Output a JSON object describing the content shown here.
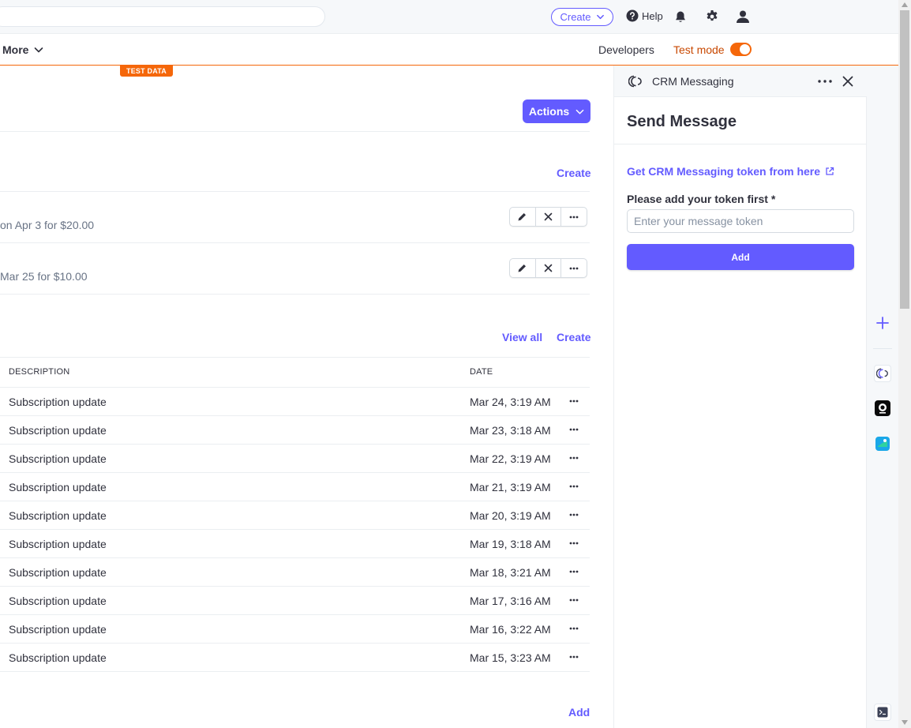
{
  "topbar": {
    "create_label": "Create",
    "help_label": "Help"
  },
  "nav": {
    "more_label": "More",
    "developers_label": "Developers",
    "test_mode_label": "Test mode",
    "test_mode_on": true,
    "test_data_badge": "TEST DATA"
  },
  "main": {
    "actions_label": "Actions",
    "section1": {
      "create_label": "Create",
      "items": [
        {
          "text": "on Apr 3 for $20.00"
        },
        {
          "text": "Mar 25 for $10.00"
        }
      ]
    },
    "section2": {
      "view_all_label": "View all",
      "create_label": "Create",
      "columns": {
        "description": "DESCRIPTION",
        "date": "DATE"
      },
      "rows": [
        {
          "description": "Subscription update",
          "date": "Mar 24, 3:19 AM"
        },
        {
          "description": "Subscription update",
          "date": "Mar 23, 3:18 AM"
        },
        {
          "description": "Subscription update",
          "date": "Mar 22, 3:19 AM"
        },
        {
          "description": "Subscription update",
          "date": "Mar 21, 3:19 AM"
        },
        {
          "description": "Subscription update",
          "date": "Mar 20, 3:19 AM"
        },
        {
          "description": "Subscription update",
          "date": "Mar 19, 3:18 AM"
        },
        {
          "description": "Subscription update",
          "date": "Mar 18, 3:21 AM"
        },
        {
          "description": "Subscription update",
          "date": "Mar 17, 3:16 AM"
        },
        {
          "description": "Subscription update",
          "date": "Mar 16, 3:22 AM"
        },
        {
          "description": "Subscription update",
          "date": "Mar 15, 3:23 AM"
        }
      ]
    },
    "add_label": "Add"
  },
  "panel": {
    "app_name": "CRM Messaging",
    "heading": "Send Message",
    "token_link": "Get CRM Messaging token from here",
    "token_label": "Please add your token first *",
    "token_placeholder": "Enter your message token",
    "token_value": "",
    "add_button": "Add"
  },
  "colors": {
    "accent": "#635bff",
    "test_mode": "#f5670a",
    "test_mode_text": "#c84801"
  }
}
